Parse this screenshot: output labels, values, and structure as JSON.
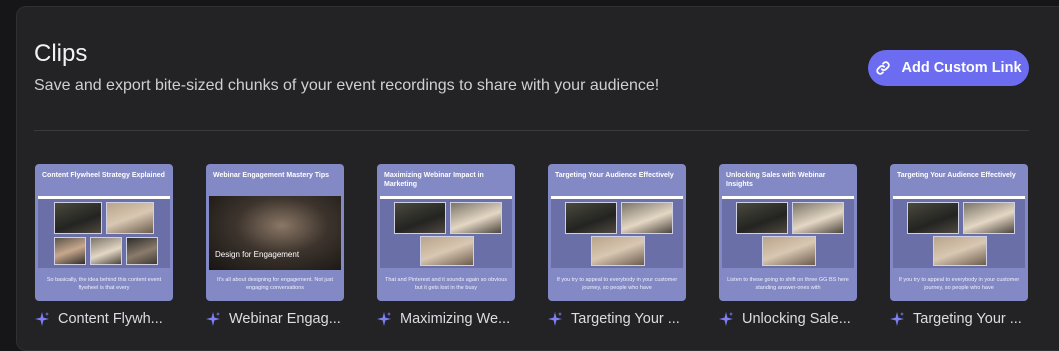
{
  "header": {
    "title": "Clips",
    "subtitle": "Save and export bite-sized chunks of your event recordings to share with your audience!",
    "add_button_label": "Add Custom Link"
  },
  "colors": {
    "accent": "#6b6cf0",
    "thumb_bg": "#8289c4",
    "panel": "#232325"
  },
  "clips": [
    {
      "thumb_title": "Content Flywheel Strategy Explained",
      "caption": "So basically, the idea behind this content event flywheel is that every",
      "label": "Content Flywh..."
    },
    {
      "thumb_title": "Webinar Engagement Mastery Tips",
      "caption": "It's all about designing for engagement. Not just engaging conversations",
      "label": "Webinar Engag...",
      "video_text": "Design for Engagement"
    },
    {
      "thumb_title": "Maximizing Webinar Impact in Marketing",
      "caption": "That and Pinterest and it sounds again so obvious but it gets lost in the busy",
      "label": "Maximizing We..."
    },
    {
      "thumb_title": "Targeting Your Audience Effectively",
      "caption": "If you try to appeal to everybody in your customer journey, so people who have",
      "label": "Targeting Your ..."
    },
    {
      "thumb_title": "Unlocking Sales with Webinar Insights",
      "caption": "Listen to these going to shift on three GG BS here standing answer-ones with",
      "label": "Unlocking Sale..."
    },
    {
      "thumb_title": "Targeting Your Audience Effectively",
      "caption": "If you try to appeal to everybody in your customer journey, so people who have",
      "label": "Targeting Your ..."
    }
  ]
}
